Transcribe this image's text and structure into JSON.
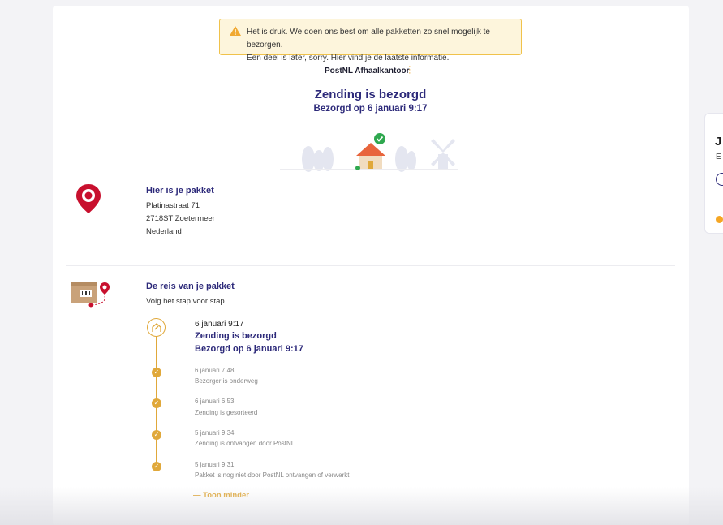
{
  "warning": {
    "line1": "Het is druk. We doen ons best om alle pakketten zo snel mogelijk te bezorgen.",
    "line2": "Een deel is later, sorry. Hier vind je de laatste informatie."
  },
  "header": {
    "office_label": "PostNL Afhaalkantoor",
    "title": "Zending is bezorgd",
    "subtitle": "Bezorgd op 6 januari 9:17"
  },
  "location": {
    "title": "Hier is je pakket",
    "street": "Platinastraat 71",
    "city": "2718ST Zoetermeer",
    "country": "Nederland"
  },
  "journey": {
    "title": "De reis van je pakket",
    "subtitle": "Volg het stap voor stap",
    "latest": {
      "date": "6 januari 9:17",
      "title": "Zending is bezorgd",
      "subtitle": "Bezorgd op 6 januari 9:17"
    },
    "events": [
      {
        "date": "6 januari 7:48",
        "text": "Bezorger is onderweg"
      },
      {
        "date": "6 januari 6:53",
        "text": "Zending is gesorteerd"
      },
      {
        "date": "5 januari 9:34",
        "text": "Zending is ontvangen door PostNL"
      },
      {
        "date": "5 januari 9:31",
        "text": "Pakket is nog niet door PostNL ontvangen of verwerkt"
      }
    ],
    "toggle_label": "Toon minder"
  },
  "side_card": {
    "initial": "J",
    "text": "E"
  },
  "colors": {
    "primary": "#2d2a7a",
    "accent": "#e0a83a",
    "pin": "#c8102e",
    "warning_bg": "#fdf5dc"
  },
  "icons": [
    "warning-icon",
    "location-pin-icon",
    "parcel-icon",
    "home-icon",
    "check-icon"
  ]
}
